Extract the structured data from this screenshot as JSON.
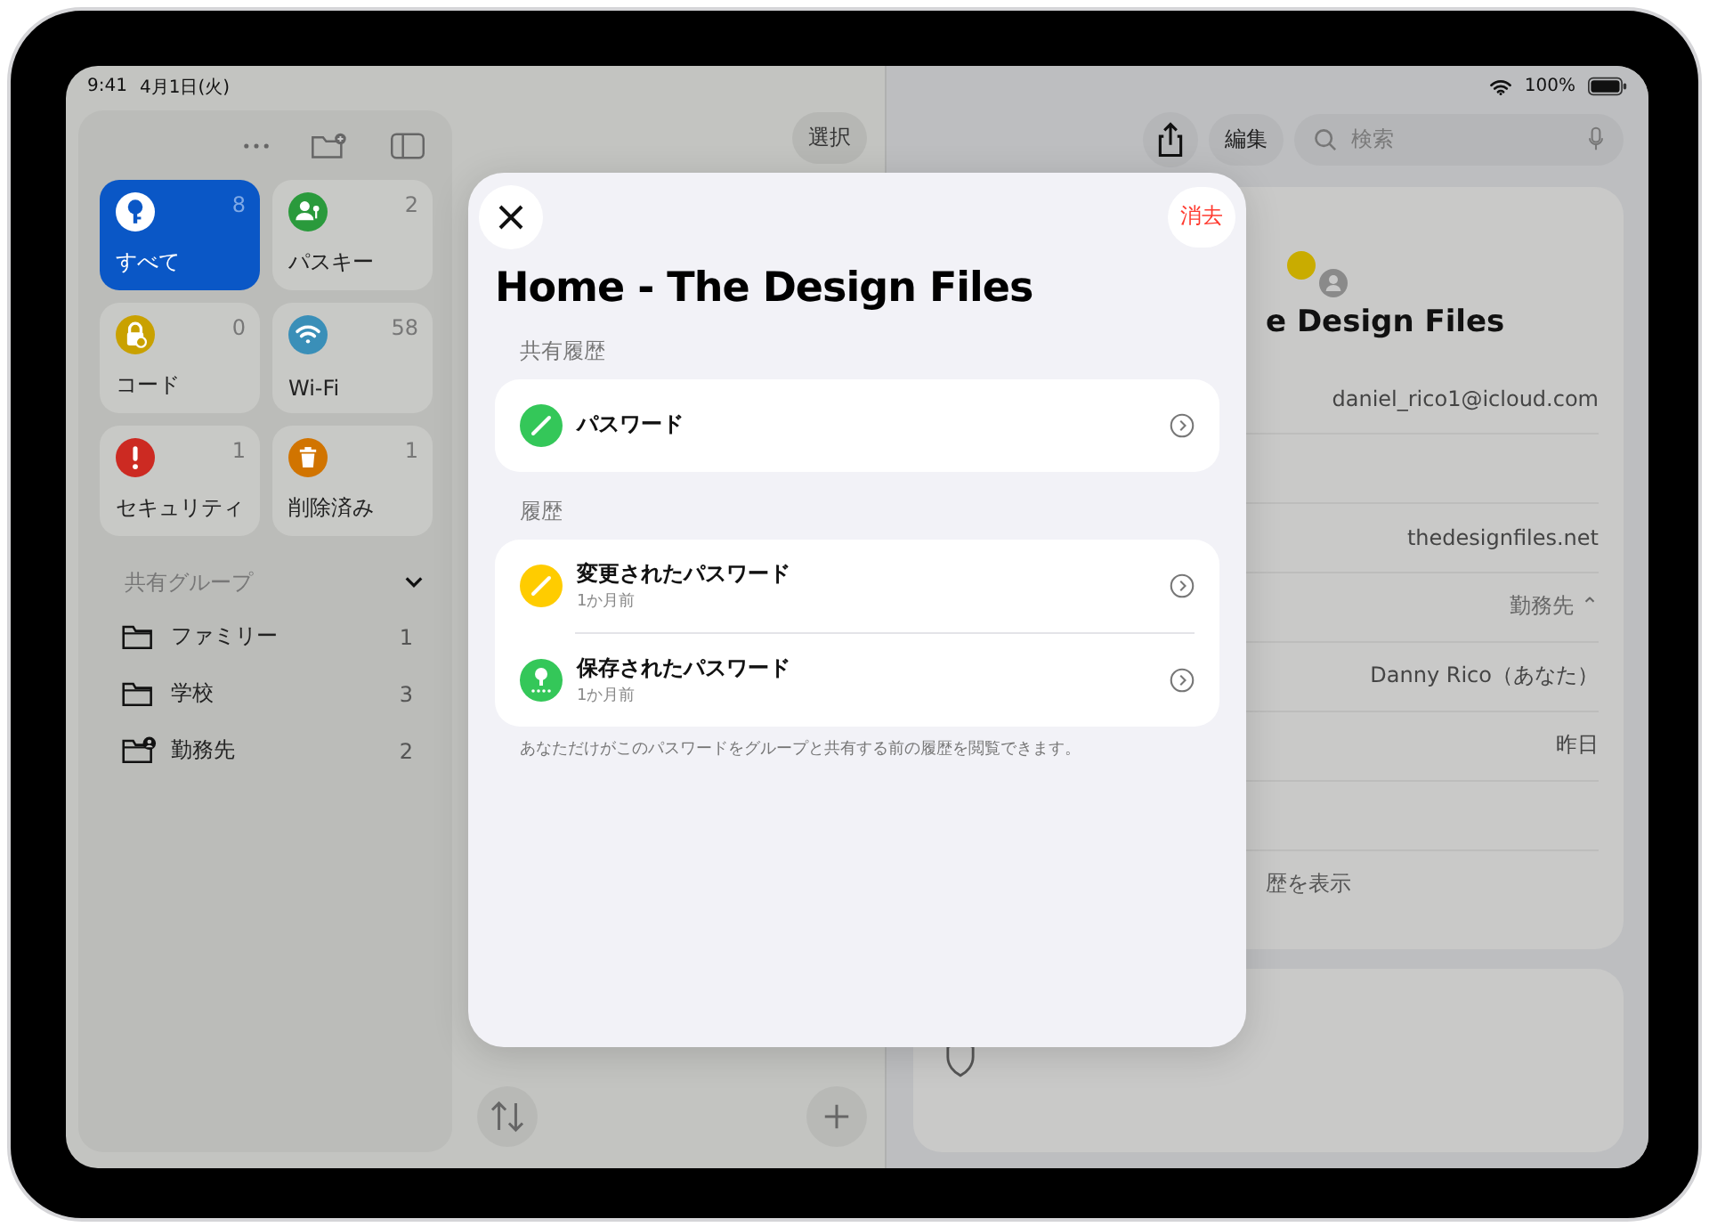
{
  "status_bar": {
    "time": "9:41",
    "date": "4月1日(火)",
    "battery": "100%"
  },
  "sidebar": {
    "categories": [
      {
        "label": "すべて",
        "count": "8",
        "kind": "key",
        "color": "#ffffff",
        "selected": true
      },
      {
        "label": "パスキー",
        "count": "2",
        "kind": "passkey",
        "color": "#2a9a3c",
        "selected": false
      },
      {
        "label": "コード",
        "count": "0",
        "kind": "code",
        "color": "#c9a100",
        "selected": false
      },
      {
        "label": "Wi-Fi",
        "count": "58",
        "kind": "wifi",
        "color": "#3a8fb8",
        "selected": false
      },
      {
        "label": "セキュリティ",
        "count": "1",
        "kind": "security",
        "color": "#cc2a22",
        "selected": false
      },
      {
        "label": "削除済み",
        "count": "1",
        "kind": "deleted",
        "color": "#d17400",
        "selected": false
      }
    ],
    "shared_groups": {
      "heading": "共有グループ",
      "expanded": true,
      "items": [
        {
          "label": "ファミリー",
          "count": "1",
          "kind": "folder"
        },
        {
          "label": "学校",
          "count": "3",
          "kind": "folder"
        },
        {
          "label": "勤務先",
          "count": "2",
          "kind": "shared-folder"
        }
      ]
    }
  },
  "list_toolbar": {
    "select_button": "選択"
  },
  "detail_toolbar": {
    "edit_button": "編集",
    "search": {
      "placeholder": "検索"
    }
  },
  "detail": {
    "title": "e Design Files",
    "rows": [
      {
        "kind": "text",
        "value": "daniel_rico1@icloud.com"
      },
      {
        "kind": "blank"
      },
      {
        "kind": "text",
        "value": "thedesignfiles.net"
      },
      {
        "kind": "picker",
        "value": "勤務先",
        "glyph": "⌃"
      },
      {
        "kind": "text",
        "value": "Danny Rico（あなた）"
      },
      {
        "kind": "text",
        "value": "昨日"
      },
      {
        "kind": "blank"
      },
      {
        "kind": "action",
        "value": "歴を表示"
      }
    ]
  },
  "modal": {
    "clear_button": "消去",
    "title": "Home - The Design Files",
    "sections": [
      {
        "heading": "共有履歴",
        "items": [
          {
            "title": "パスワード",
            "kind": "changed",
            "color": "#34c759"
          }
        ]
      },
      {
        "heading": "履歴",
        "items": [
          {
            "title": "変更されたパスワード",
            "subtitle": "1か月前",
            "kind": "changed",
            "color": "#ffcc00"
          },
          {
            "title": "保存されたパスワード",
            "subtitle": "1か月前",
            "kind": "saved",
            "color": "#34c759"
          }
        ]
      }
    ],
    "footer": "あなただけがこのパスワードをグループと共有する前の履歴を閲覧できます。"
  }
}
